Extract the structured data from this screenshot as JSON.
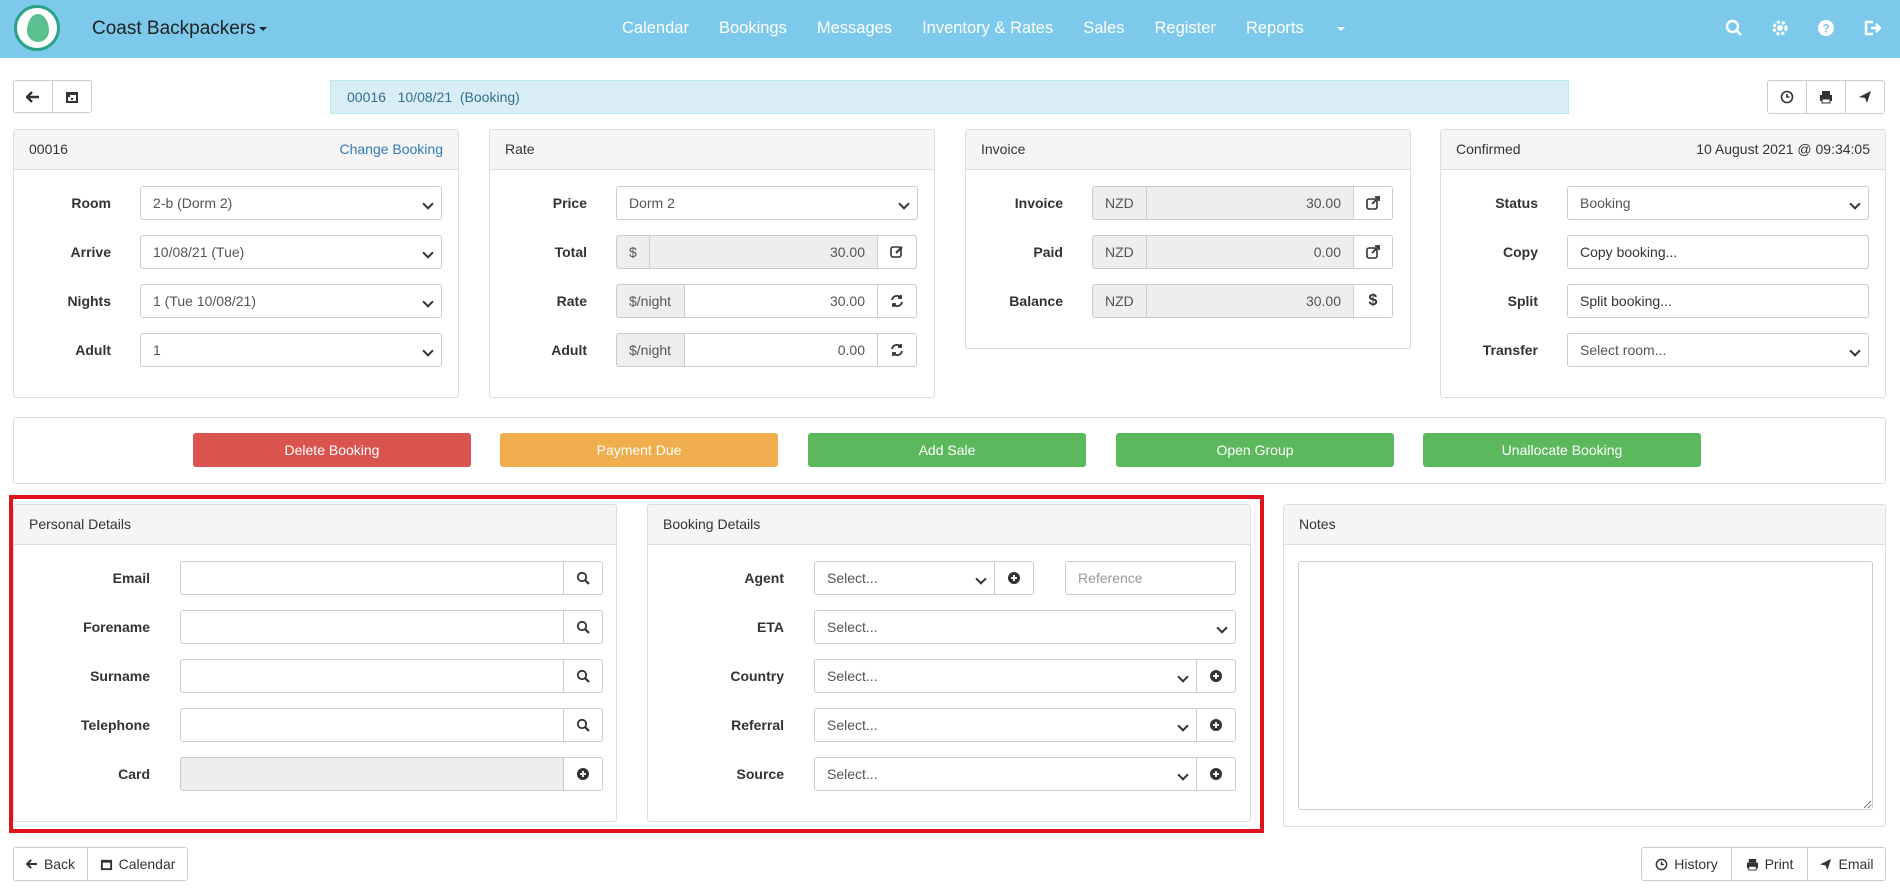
{
  "nav": {
    "brand": "Coast Backpackers",
    "links": [
      "Calendar",
      "Bookings",
      "Messages",
      "Inventory & Rates",
      "Sales",
      "Register",
      "Reports"
    ],
    "icons": [
      "search-icon",
      "gear-icon",
      "help-icon",
      "logout-icon"
    ]
  },
  "crumb": {
    "id": "00016",
    "date": "10/08/21",
    "type": "(Booking)"
  },
  "booking_panel": {
    "id": "00016",
    "change_label": "Change Booking",
    "fields": [
      {
        "label": "Room",
        "value": "2-b (Dorm 2)"
      },
      {
        "label": "Arrive",
        "value": "10/08/21  (Tue)"
      },
      {
        "label": "Nights",
        "value": "1  (Tue 10/08/21)"
      },
      {
        "label": "Adult",
        "value": "1"
      }
    ]
  },
  "rate_panel": {
    "title": "Rate",
    "price_label": "Price",
    "price_value": "Dorm 2",
    "total_label": "Total",
    "total_addon": "$",
    "total_value": "30.00",
    "rate_label": "Rate",
    "rate_addon": "$/night",
    "rate_value": "30.00",
    "adult_label": "Adult",
    "adult_addon": "$/night",
    "adult_value": "0.00"
  },
  "invoice_panel": {
    "title": "Invoice",
    "rows": [
      {
        "label": "Invoice",
        "currency": "NZD",
        "value": "30.00",
        "icon": "external-link-icon"
      },
      {
        "label": "Paid",
        "currency": "NZD",
        "value": "0.00",
        "icon": "external-link-icon"
      },
      {
        "label": "Balance",
        "currency": "NZD",
        "value": "30.00",
        "icon": "dollar-icon"
      }
    ]
  },
  "status_panel": {
    "title": "Confirmed",
    "timestamp": "10 August 2021 @ 09:34:05",
    "status_label": "Status",
    "status_value": "Booking",
    "copy_label": "Copy",
    "copy_value": "Copy booking...",
    "split_label": "Split",
    "split_value": "Split booking...",
    "transfer_label": "Transfer",
    "transfer_value": "Select room..."
  },
  "actions": [
    {
      "label": "Delete Booking",
      "color": "#d9534f"
    },
    {
      "label": "Payment Due",
      "color": "#f0ad4e"
    },
    {
      "label": "Add Sale",
      "color": "#5cb85c"
    },
    {
      "label": "Open Group",
      "color": "#5cb85c"
    },
    {
      "label": "Unallocate Booking",
      "color": "#5cb85c"
    }
  ],
  "personal": {
    "title": "Personal Details",
    "fields": [
      {
        "label": "Email",
        "value": ""
      },
      {
        "label": "Forename",
        "value": ""
      },
      {
        "label": "Surname",
        "value": ""
      },
      {
        "label": "Telephone",
        "value": ""
      },
      {
        "label": "Card",
        "value": ""
      }
    ]
  },
  "booking_details": {
    "title": "Booking Details",
    "agent_label": "Agent",
    "agent_value": "Select...",
    "reference_placeholder": "Reference",
    "eta_label": "ETA",
    "eta_value": "Select...",
    "country_label": "Country",
    "country_value": "Select...",
    "referral_label": "Referral",
    "referral_value": "Select...",
    "source_label": "Source",
    "source_value": "Select..."
  },
  "notes": {
    "title": "Notes",
    "value": ""
  },
  "footer": {
    "back_label": "Back",
    "calendar_label": "Calendar",
    "history_label": "History",
    "print_label": "Print",
    "email_label": "Email"
  },
  "colors": {
    "nav": "#7cc9ec",
    "highlight": "#e0121c"
  }
}
